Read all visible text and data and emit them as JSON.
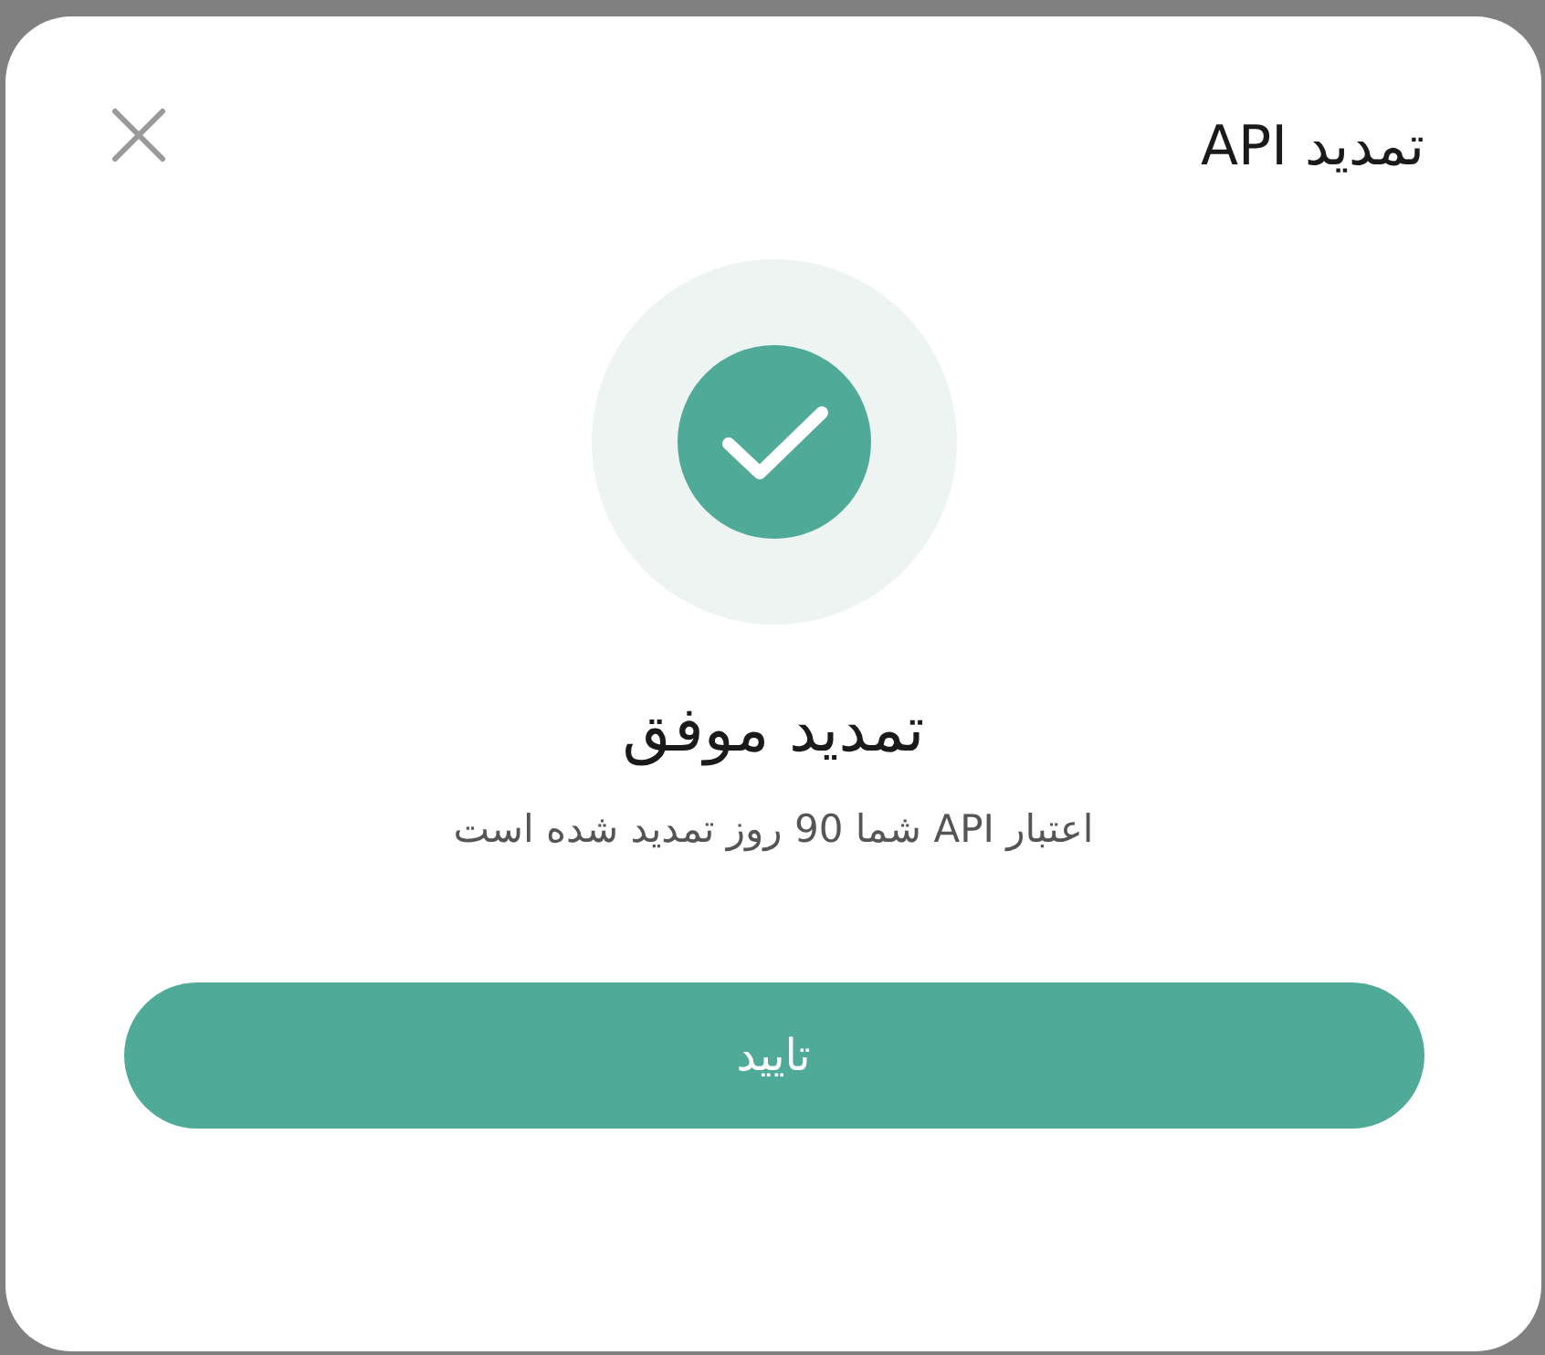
{
  "dialog": {
    "title": "تمدید API"
  },
  "result": {
    "success": true,
    "heading": "تمدید موفق",
    "message": "اعتبار API شما 90 روز تمدید شده است"
  },
  "buttons": [
    {
      "label": "تایید"
    }
  ]
}
